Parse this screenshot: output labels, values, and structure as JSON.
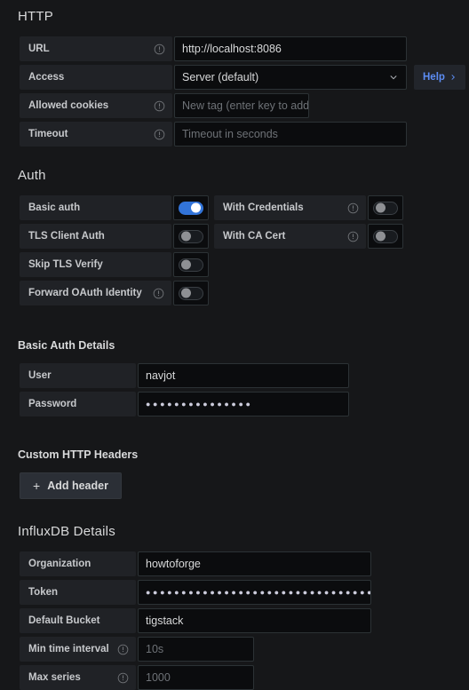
{
  "sections": {
    "http": {
      "title": "HTTP",
      "rows": [
        {
          "label": "URL",
          "info": true,
          "value": "http://localhost:8086",
          "placeholder": "",
          "type": "text"
        },
        {
          "label": "Access",
          "info": false,
          "value": "Server (default)",
          "placeholder": "",
          "type": "select"
        },
        {
          "label": "Allowed cookies",
          "info": true,
          "value": "",
          "placeholder": "New tag (enter key to add)",
          "type": "tag"
        },
        {
          "label": "Timeout",
          "info": true,
          "value": "",
          "placeholder": "Timeout in seconds",
          "type": "text"
        }
      ],
      "help_label": "Help",
      "access_option": "Server (default)"
    },
    "auth": {
      "title": "Auth",
      "left": [
        {
          "label": "Basic auth",
          "info": false,
          "state": "on"
        },
        {
          "label": "TLS Client Auth",
          "info": false,
          "state": "off"
        },
        {
          "label": "Skip TLS Verify",
          "info": false,
          "state": "off"
        },
        {
          "label": "Forward OAuth Identity",
          "info": true,
          "state": "off"
        }
      ],
      "right": [
        {
          "label": "With Credentials",
          "info": true,
          "state": "off"
        },
        {
          "label": "With CA Cert",
          "info": true,
          "state": "off"
        }
      ]
    },
    "basic_auth_details": {
      "title": "Basic Auth Details",
      "rows": [
        {
          "label": "User",
          "info": false,
          "value": "navjot",
          "placeholder": "",
          "type": "text"
        },
        {
          "label": "Password",
          "info": false,
          "value": "●●●●●●●●●●●●●●●",
          "placeholder": "",
          "type": "password"
        }
      ]
    },
    "custom_http_headers": {
      "title": "Custom HTTP Headers",
      "add_header_label": "Add header",
      "plus_glyph": "+"
    },
    "influxdb_details": {
      "title": "InfluxDB Details",
      "rows": [
        {
          "label": "Organization",
          "info": false,
          "value": "howtoforge",
          "placeholder": "",
          "type": "text"
        },
        {
          "label": "Token",
          "info": false,
          "value": "●●●●●●●●●●●●●●●●●●●●●●●●●●●●●●●●●●●●●●●●",
          "placeholder": "",
          "type": "password"
        },
        {
          "label": "Default Bucket",
          "info": false,
          "value": "tigstack",
          "placeholder": "",
          "type": "text"
        },
        {
          "label": "Min time interval",
          "info": true,
          "value": "",
          "placeholder": "10s",
          "type": "short"
        },
        {
          "label": "Max series",
          "info": true,
          "value": "",
          "placeholder": "1000",
          "type": "short"
        }
      ]
    }
  },
  "colors": {
    "background": "#161719",
    "label_bg": "#202226",
    "input_bg": "#0b0c0e",
    "border": "#2c3235",
    "accent_blue": "#3274d9",
    "link_blue": "#5c8df5",
    "text": "#d8d9da",
    "placeholder": "#6e7277"
  },
  "icons": {
    "info": "info-circle-icon",
    "chevron_down": "chevron-down-icon",
    "chevron_right": "chevron-right-icon",
    "plus": "plus-icon"
  }
}
